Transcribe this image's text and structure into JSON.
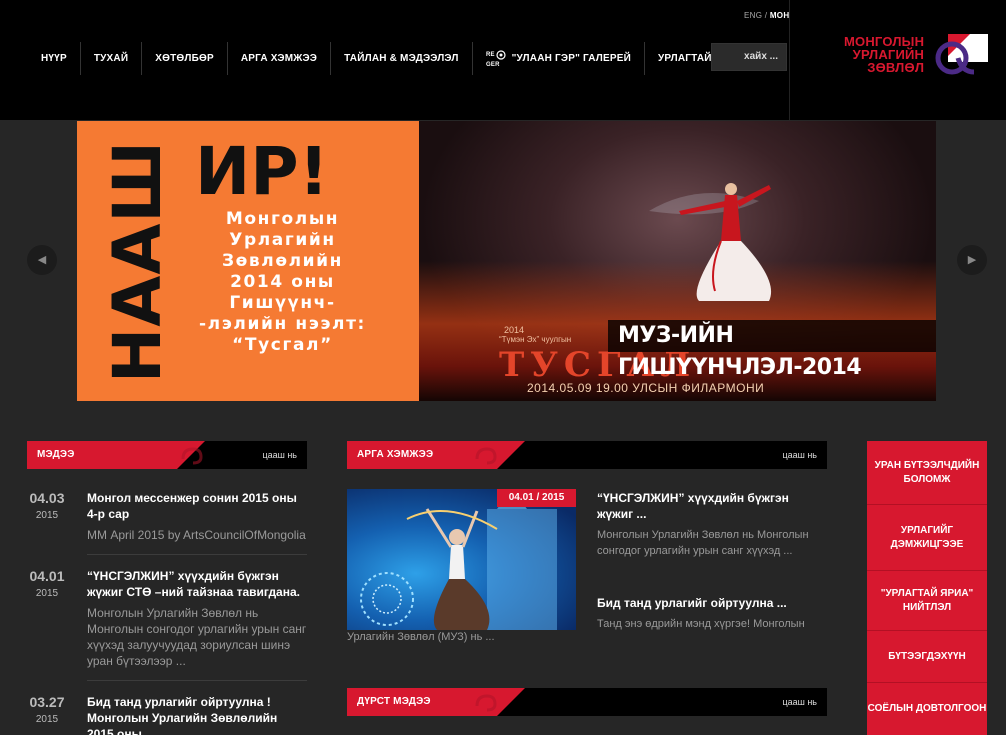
{
  "header": {
    "lang_eng": "ENG",
    "lang_sep": " / ",
    "lang_mon": "МОН",
    "nav": [
      {
        "label": "НҮҮР"
      },
      {
        "label": "ТУХАЙ"
      },
      {
        "label": "ХӨТӨЛБӨР"
      },
      {
        "label": "АРГА ХЭМЖЭЭ"
      },
      {
        "label": "ТАЙЛАН & МЭДЭЭЛЭЛ"
      },
      {
        "label": "\"УЛААН ГЭР\" ГАЛЕРЕЙ"
      },
      {
        "label": "УРЛАГТАЙ ЯРИА"
      }
    ],
    "gallery_logo_text": "RE GER",
    "search_placeholder": "хайх ...",
    "logo": {
      "line1": "МОНГОЛЫН",
      "line2": "УРЛАГИЙН",
      "line3": "ЗӨВЛӨЛ",
      "color": "#d8182f"
    }
  },
  "slider": {
    "vertical_text": "НААШ",
    "big_text": "ИР!",
    "poster_text": "Монголын Урлагийн Зөвлөлийн 2014 оны Гишүүнч- -лэлийн нээлт: “Тусгал”",
    "small_line1": "2014",
    "small_line2": "“Түмэн Эх” чуулгын",
    "title_art": "ТУСГАЛ",
    "date_line": "2014.05.09 19.00  УЛСЫН ФИЛАРМОНИ",
    "caption": "МУЗ-ИЙН ГИШҮҮНЧЛЭЛ-2014",
    "prev_icon": "◀",
    "next_icon": "▶"
  },
  "news": {
    "title": "МЭДЭЭ",
    "more": "цааш нь",
    "items": [
      {
        "day": "04.03",
        "year": "2015",
        "title": "Монгол мессенжер сонин 2015 оны 4-р сар",
        "text": "ММ April 2015 by ArtsCouncilOfMongolia"
      },
      {
        "day": "04.01",
        "year": "2015",
        "title": "“ҮНСГЭЛЖИН” хүүхдийн бүжгэн жүжиг СТӨ –ний тайзнаа тавигдана.",
        "text": "Монголын Урлагийн Зөвлөл нь Монголын сонгодог урлагийн урын санг хүүхэд залуучуудад зориулсан шинэ уран бүтээлээр ..."
      },
      {
        "day": "03.27",
        "year": "2015",
        "title": "Бид танд урлагийг ойртуулна ! Монголын Урлагийн Зөвлөлийн 2015 оны",
        "text": ""
      }
    ]
  },
  "events": {
    "title": "АРГА ХЭМЖЭЭ",
    "more": "цааш нь",
    "badge": "04.01 / 2015",
    "image_caption": "Урлагийн Зөвлөл (МУЗ) нь ...",
    "items": [
      {
        "title": "“ҮНСГЭЛЖИН” хүүхдийн бүжгэн жүжиг ...",
        "text": "Монголын Урлагийн Зөвлөл нь Монголын сонгодог урлагийн урын санг хүүхэд ..."
      },
      {
        "title": "Бид танд урлагийг ойртуулна ...",
        "text": "Танд энэ өдрийн мэнд хүргэе! Монголын"
      }
    ]
  },
  "featured": {
    "title": "ДҮРСТ МЭДЭЭ",
    "more": "цааш нь"
  },
  "side_menu": {
    "items": [
      {
        "label": "УРАН БҮТЭЭЛЧДИЙН БОЛОМЖ"
      },
      {
        "label": "УРЛАГИЙГ ДЭМЖИЦГЭЭЕ"
      },
      {
        "label": "\"УРЛАГТАЙ ЯРИА\" НИЙТЛЭЛ"
      },
      {
        "label": "БҮТЭЭГДЭХҮҮН"
      },
      {
        "label": "СОЁЛЫН ДОВТОЛГООН"
      }
    ]
  },
  "colors": {
    "accent": "#d7182f",
    "header_bg": "#000000",
    "page_bg": "#262626"
  }
}
